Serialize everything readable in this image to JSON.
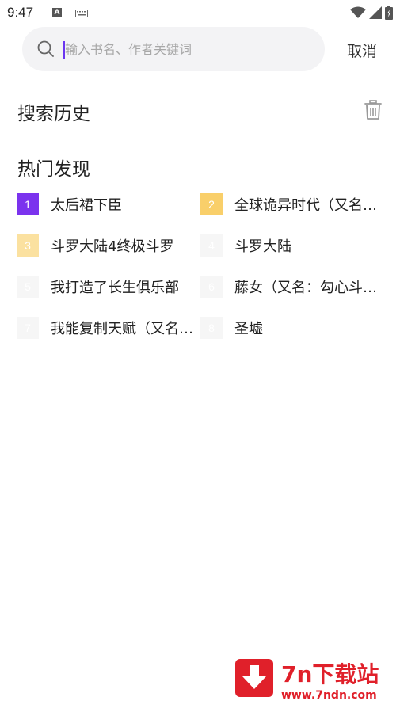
{
  "status_bar": {
    "time": "9:47",
    "notification_badge": "A",
    "icons": [
      "keyboard-icon",
      "wifi-icon",
      "signal-icon",
      "battery-charging-icon"
    ]
  },
  "search": {
    "placeholder": "输入书名、作者关键词",
    "value": "",
    "cancel_label": "取消",
    "accent_color": "#6b36f0"
  },
  "history": {
    "title": "搜索历史",
    "clear_icon": "trash-icon"
  },
  "hot": {
    "title": "热门发现",
    "items": [
      {
        "rank": "1",
        "title": "太后裙下臣",
        "color": "#7b33ee"
      },
      {
        "rank": "2",
        "title": "全球诡异时代（又名：我的诡异娘子）",
        "color": "#f9cf6a"
      },
      {
        "rank": "3",
        "title": "斗罗大陆4终极斗罗",
        "color": "#fbe1a0"
      },
      {
        "rank": "4",
        "title": "斗罗大陆",
        "color": "#f6f6f6"
      },
      {
        "rank": "5",
        "title": "我打造了长生俱乐部",
        "color": "#f6f6f6"
      },
      {
        "rank": "6",
        "title": "藤女（又名：勾心斗角）",
        "color": "#f6f6f6"
      },
      {
        "rank": "7",
        "title": "我能复制天赋（又名：超神复制）",
        "color": "#f6f6f6"
      },
      {
        "rank": "8",
        "title": "圣墟",
        "color": "#f6f6f6"
      }
    ]
  },
  "watermark": {
    "title": "7n下载站",
    "url": "www.7ndn.com",
    "color": "#e0202a"
  }
}
